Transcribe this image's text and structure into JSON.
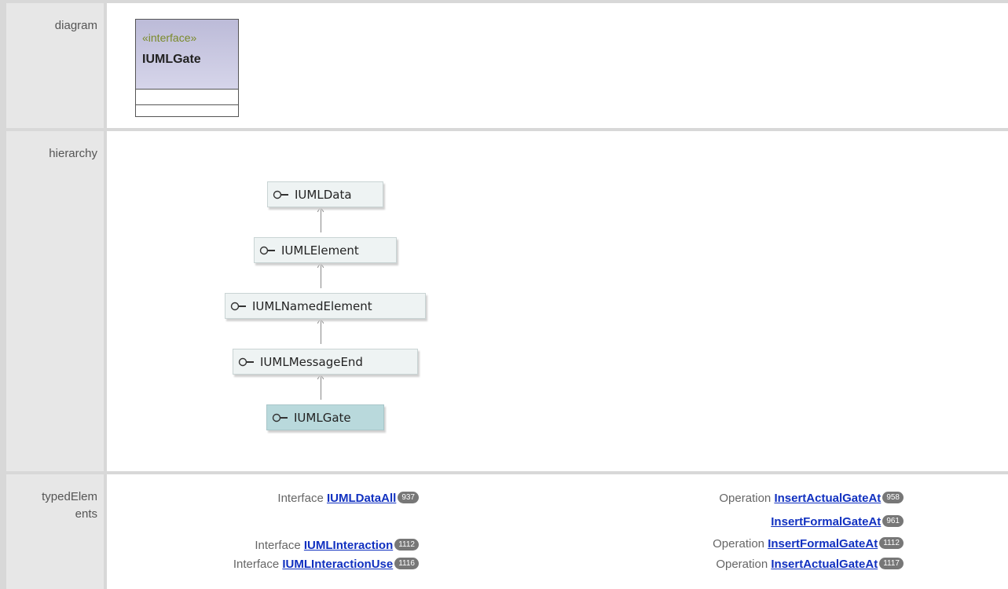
{
  "rows": {
    "diagram_label": "diagram",
    "hierarchy_label": "hierarchy",
    "typed_label_1": "typedElem",
    "typed_label_2": "ents"
  },
  "uml": {
    "stereotype": "«interface»",
    "name": "IUMLGate"
  },
  "hierarchy": {
    "nodes": [
      "IUMLData",
      "IUMLElement",
      "IUMLNamedElement",
      "IUMLMessageEnd",
      "IUMLGate"
    ]
  },
  "typed": {
    "left": [
      {
        "kind": "Interface",
        "name": "IUMLDataAll",
        "count": "937"
      },
      {
        "kind": "Interface",
        "name": "IUMLInteraction",
        "count": "1112"
      },
      {
        "kind": "Interface",
        "name": "IUMLInteractionUse",
        "count": "1116"
      }
    ],
    "right": [
      {
        "kind": "Operation",
        "name": "InsertActualGateAt",
        "count": "958"
      },
      {
        "kind": "",
        "name": "InsertFormalGateAt",
        "count": "961"
      },
      {
        "kind": "Operation",
        "name": "InsertFormalGateAt",
        "count": "1112"
      },
      {
        "kind": "Operation",
        "name": "InsertActualGateAt",
        "count": "1117"
      }
    ]
  },
  "colors": {
    "link": "#1030c0",
    "selected_node": "#b9d9dc",
    "node": "#eef3f3"
  }
}
